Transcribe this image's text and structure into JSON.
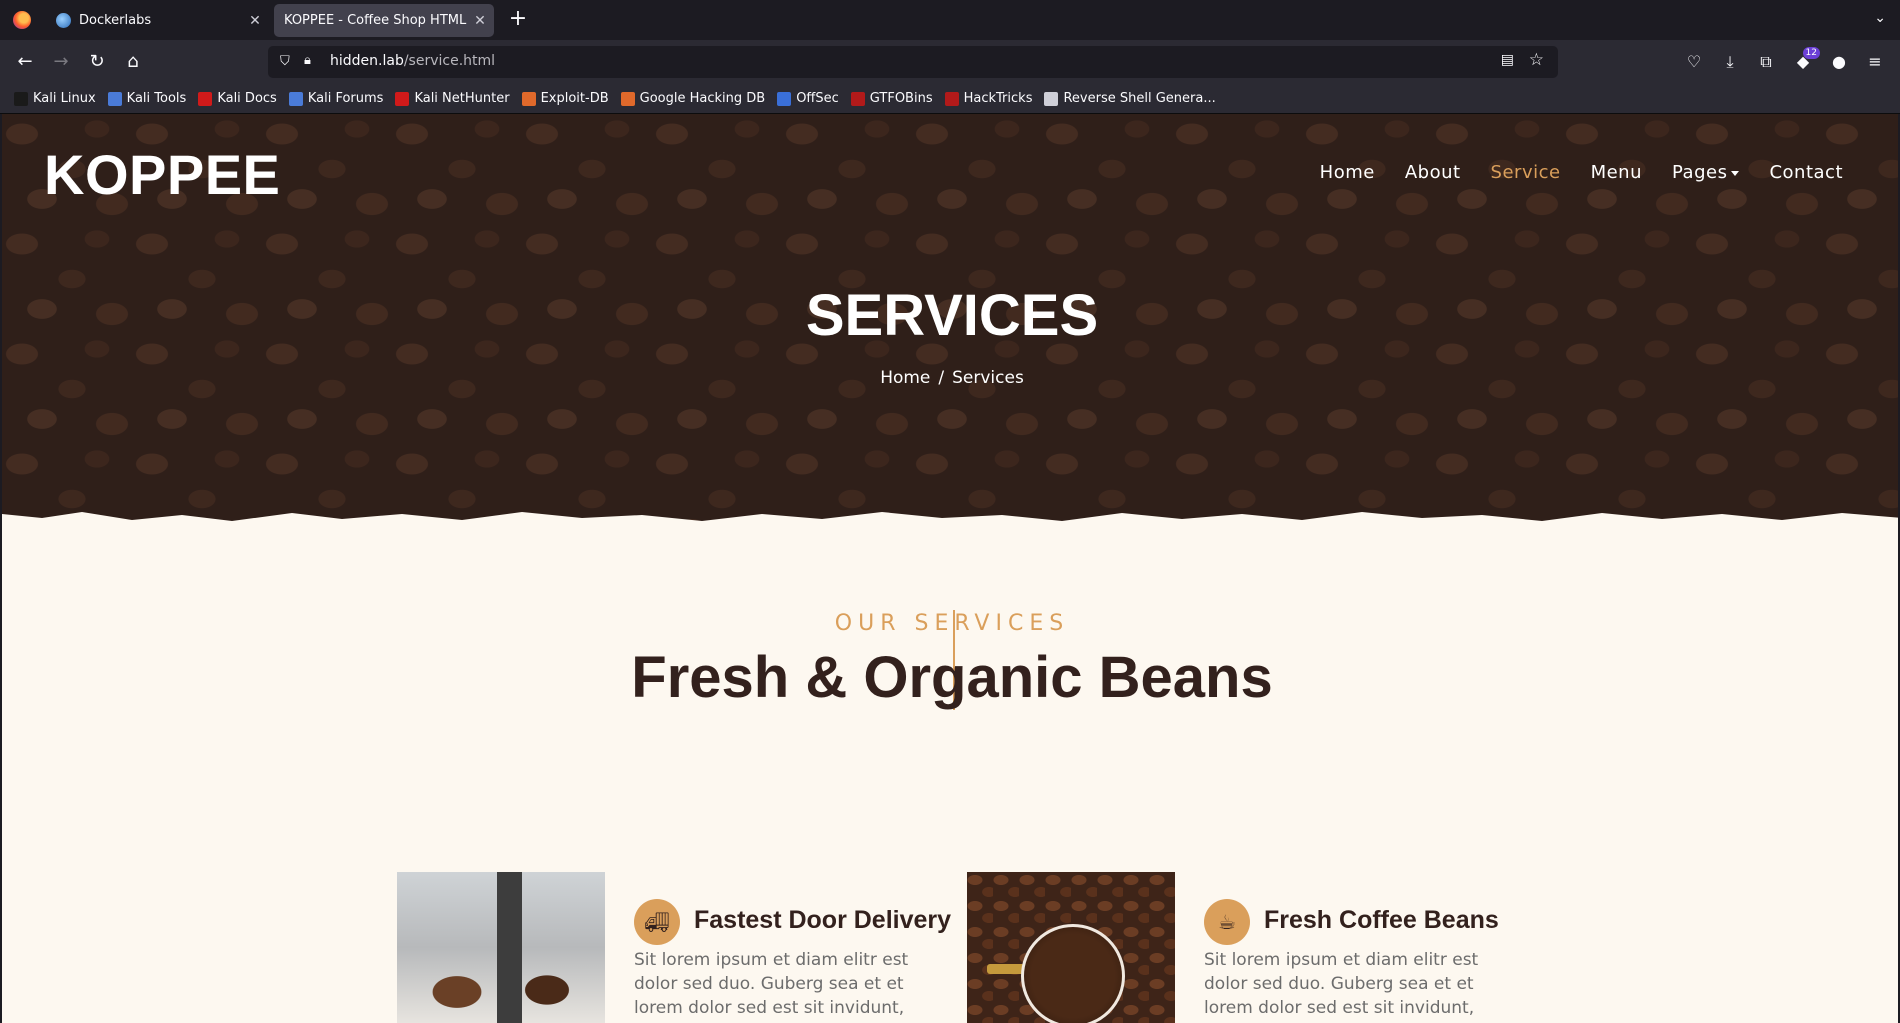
{
  "browser": {
    "tabs": [
      {
        "title": "Dockerlabs",
        "active": false
      },
      {
        "title": "KOPPEE - Coffee Shop HTML Te",
        "active": true
      }
    ],
    "url_host": "hidden.lab",
    "url_path": "/service.html",
    "extension_badge": "12",
    "bookmarks": [
      {
        "label": "Kali Linux",
        "color": "#1a1a1a"
      },
      {
        "label": "Kali Tools",
        "color": "#4a7bd8"
      },
      {
        "label": "Kali Docs",
        "color": "#d11a1a"
      },
      {
        "label": "Kali Forums",
        "color": "#4a7bd8"
      },
      {
        "label": "Kali NetHunter",
        "color": "#d11a1a"
      },
      {
        "label": "Exploit-DB",
        "color": "#e0692b"
      },
      {
        "label": "Google Hacking DB",
        "color": "#e0692b"
      },
      {
        "label": "OffSec",
        "color": "#3a6fd8"
      },
      {
        "label": "GTFOBins",
        "color": "#b21a1a"
      },
      {
        "label": "HackTricks",
        "color": "#b21a1a"
      },
      {
        "label": "Reverse Shell Genera...",
        "color": "#cfcfd8"
      }
    ]
  },
  "site": {
    "brand": "KOPPEE",
    "nav": [
      {
        "label": "Home",
        "active": false
      },
      {
        "label": "About",
        "active": false
      },
      {
        "label": "Service",
        "active": true
      },
      {
        "label": "Menu",
        "active": false
      },
      {
        "label": "Pages",
        "active": false,
        "dropdown": true
      },
      {
        "label": "Contact",
        "active": false
      }
    ],
    "hero_title": "SERVICES",
    "breadcrumb": {
      "home": "Home",
      "separator": "/",
      "current": "Services"
    },
    "section_kicker": "OUR SERVICES",
    "section_title": "Fresh & Organic Beans",
    "services": [
      {
        "icon": "truck-icon",
        "title": "Fastest Door Delivery",
        "text": "Sit lorem ipsum et diam elitr est dolor sed duo. Guberg sea et et lorem dolor sed est sit invidunt, dolore tempor"
      },
      {
        "icon": "coffee-cup-icon",
        "title": "Fresh Coffee Beans",
        "text": "Sit lorem ipsum et diam elitr est dolor sed duo. Guberg sea et et lorem dolor sed est sit invidunt, dolore tempor"
      }
    ],
    "colors": {
      "accent": "#da9f5b",
      "heading": "#33211d",
      "page_bg": "#fdf8f0"
    }
  }
}
